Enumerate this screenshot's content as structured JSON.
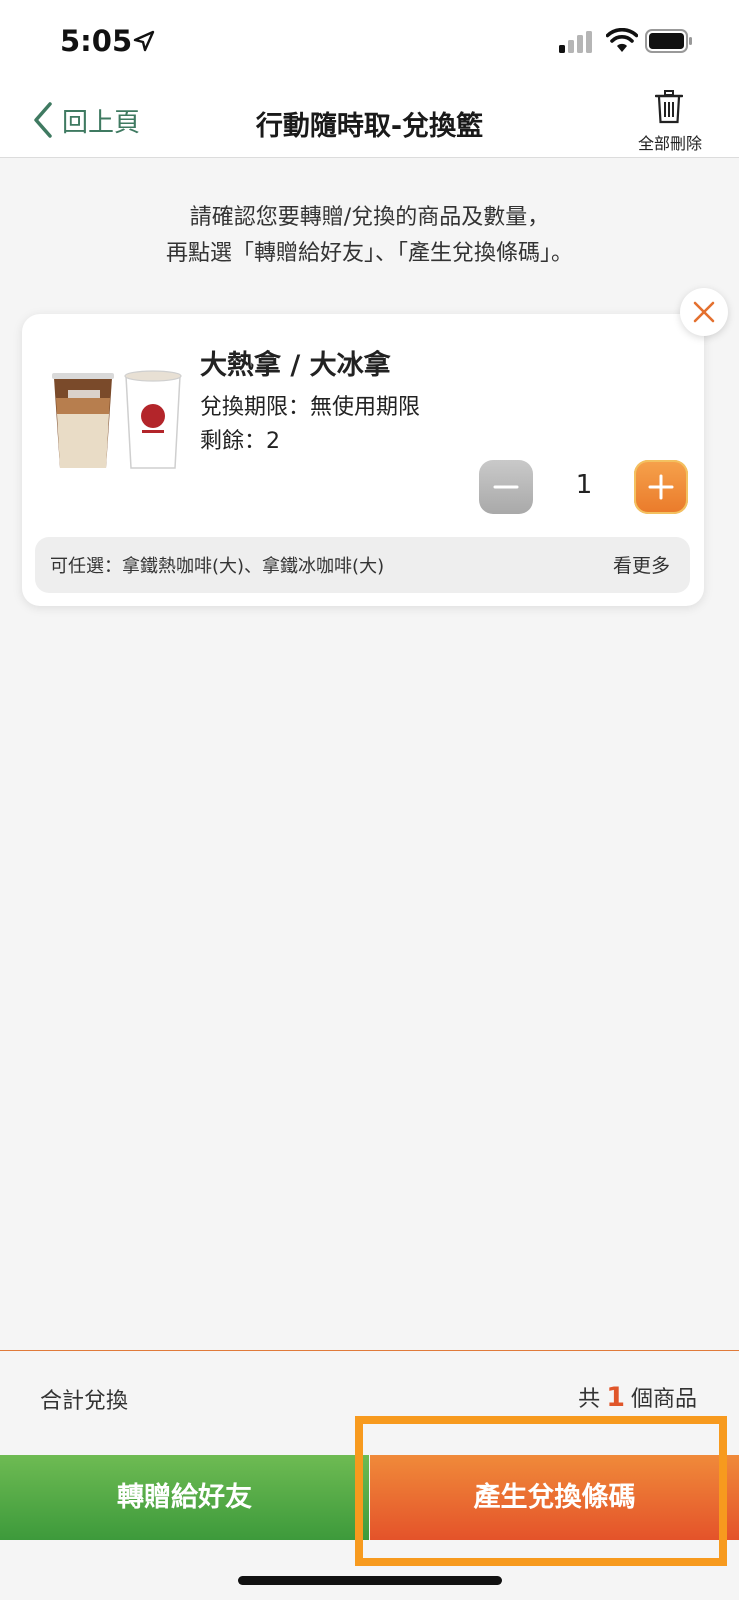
{
  "status_bar": {
    "time": "5:05"
  },
  "nav": {
    "back_label": "回上頁",
    "title": "行動隨時取-兌換籃",
    "delete_all_label": "全部刪除"
  },
  "instruction": {
    "line1": "請確認您要轉贈/兌換的商品及數量，",
    "line2": "再點選「轉贈給好友」、「產生兌換條碼」。"
  },
  "item": {
    "name": "大熱拿 / 大冰拿",
    "expiry": "兌換期限：無使用期限",
    "remaining": "剩餘：2",
    "quantity": "1",
    "options": "可任選：拿鐵熱咖啡(大)、拿鐵冰咖啡(大)",
    "see_more": "看更多"
  },
  "summary": {
    "label": "合計兌換",
    "prefix": "共",
    "count": "1",
    "suffix": "個商品"
  },
  "buttons": {
    "gift": "轉贈給好友",
    "barcode": "產生兌換條碼"
  },
  "colors": {
    "accent_orange": "#e0562a",
    "green": "#3d9a3b",
    "back_green": "#3f7a61",
    "highlight": "#f79a1e"
  }
}
